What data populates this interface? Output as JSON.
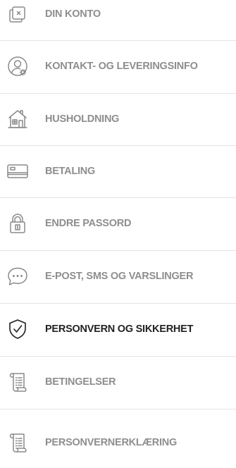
{
  "menu": {
    "items": [
      {
        "label": "DIN KONTO",
        "icon": "account-card-icon",
        "active": false
      },
      {
        "label": "KONTAKT- OG LEVERINGSINFO",
        "icon": "user-settings-icon",
        "active": false
      },
      {
        "label": "HUSHOLDNING",
        "icon": "house-icon",
        "active": false
      },
      {
        "label": "BETALING",
        "icon": "credit-card-icon",
        "active": false
      },
      {
        "label": "ENDRE PASSORD",
        "icon": "padlock-icon",
        "active": false
      },
      {
        "label": "E-POST, SMS OG VARSLINGER",
        "icon": "chat-bubble-icon",
        "active": false
      },
      {
        "label": "PERSONVERN OG SIKKERHET",
        "icon": "shield-check-icon",
        "active": true
      },
      {
        "label": "BETINGELSER",
        "icon": "scroll-document-icon",
        "active": false
      },
      {
        "label": "PERSONVERNERKLÆRING",
        "icon": "scroll-document-icon",
        "active": false
      }
    ]
  },
  "colors": {
    "inactive_text": "#8e8e8e",
    "active_text": "#222222",
    "divider": "#e4e4e4",
    "background": "#ffffff"
  }
}
